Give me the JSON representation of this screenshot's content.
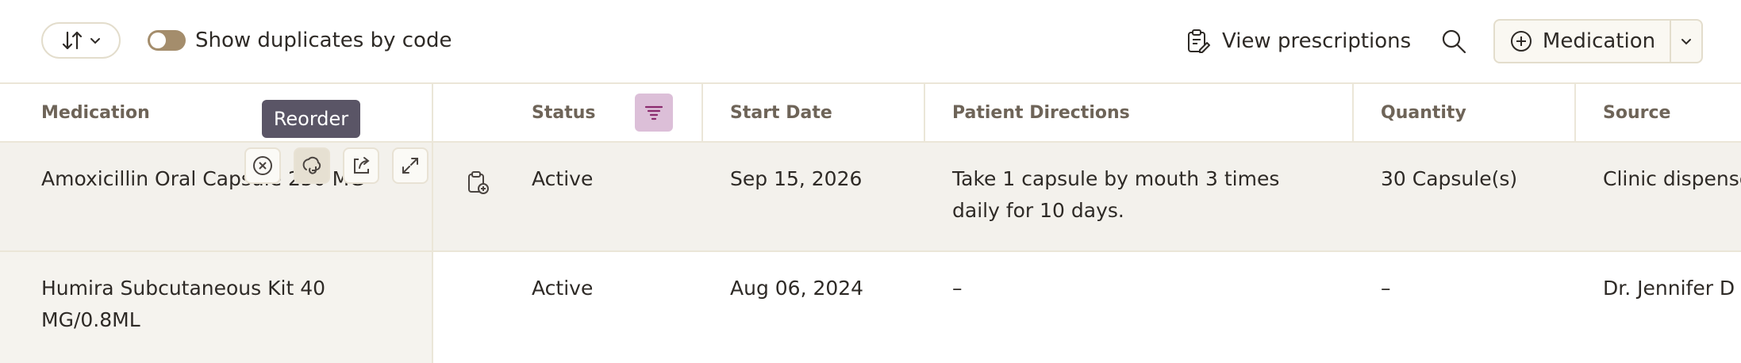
{
  "toolbar": {
    "toggle_label": "Show duplicates by code",
    "view_prescriptions_label": "View prescriptions",
    "add_medication_label": "Medication"
  },
  "table": {
    "headers": {
      "medication": "Medication",
      "status": "Status",
      "start_date": "Start Date",
      "patient_directions": "Patient Directions",
      "quantity": "Quantity",
      "source": "Source"
    },
    "rows": [
      {
        "medication": "Amoxicillin Oral Capsule 250 MG",
        "status": "Active",
        "start_date": "Sep 15, 2026",
        "directions_line1": "Take 1 capsule by mouth 3 times",
        "directions_line2": "daily for 10 days.",
        "quantity": "30 Capsule(s)",
        "source": "Clinic dispensed"
      },
      {
        "medication_line1": "Humira Subcutaneous Kit 40",
        "medication_line2": "MG/0.8ML",
        "status": "Active",
        "start_date": "Aug 06, 2024",
        "directions": "–",
        "quantity": "–",
        "source": "Dr. Jennifer D"
      }
    ]
  },
  "tooltip": {
    "reorder": "Reorder"
  },
  "icons": {
    "sort": "sort-arrows-icon",
    "view_prescriptions": "clipboard-edit-icon",
    "search": "search-icon",
    "add": "plus-circle-icon",
    "caret": "chevron-down-icon",
    "cancel": "close-circle-icon",
    "reorder": "reorder-icon",
    "share": "share-icon",
    "expand": "expand-icon",
    "row_rx": "clipboard-plus-icon",
    "filter": "filter-icon"
  },
  "colors": {
    "toggle_on": "#a48d6c",
    "filter_active_bg": "#dcbfd8",
    "tooltip_bg": "#5a5566",
    "row_hover_bg": "#f3f1ec"
  }
}
